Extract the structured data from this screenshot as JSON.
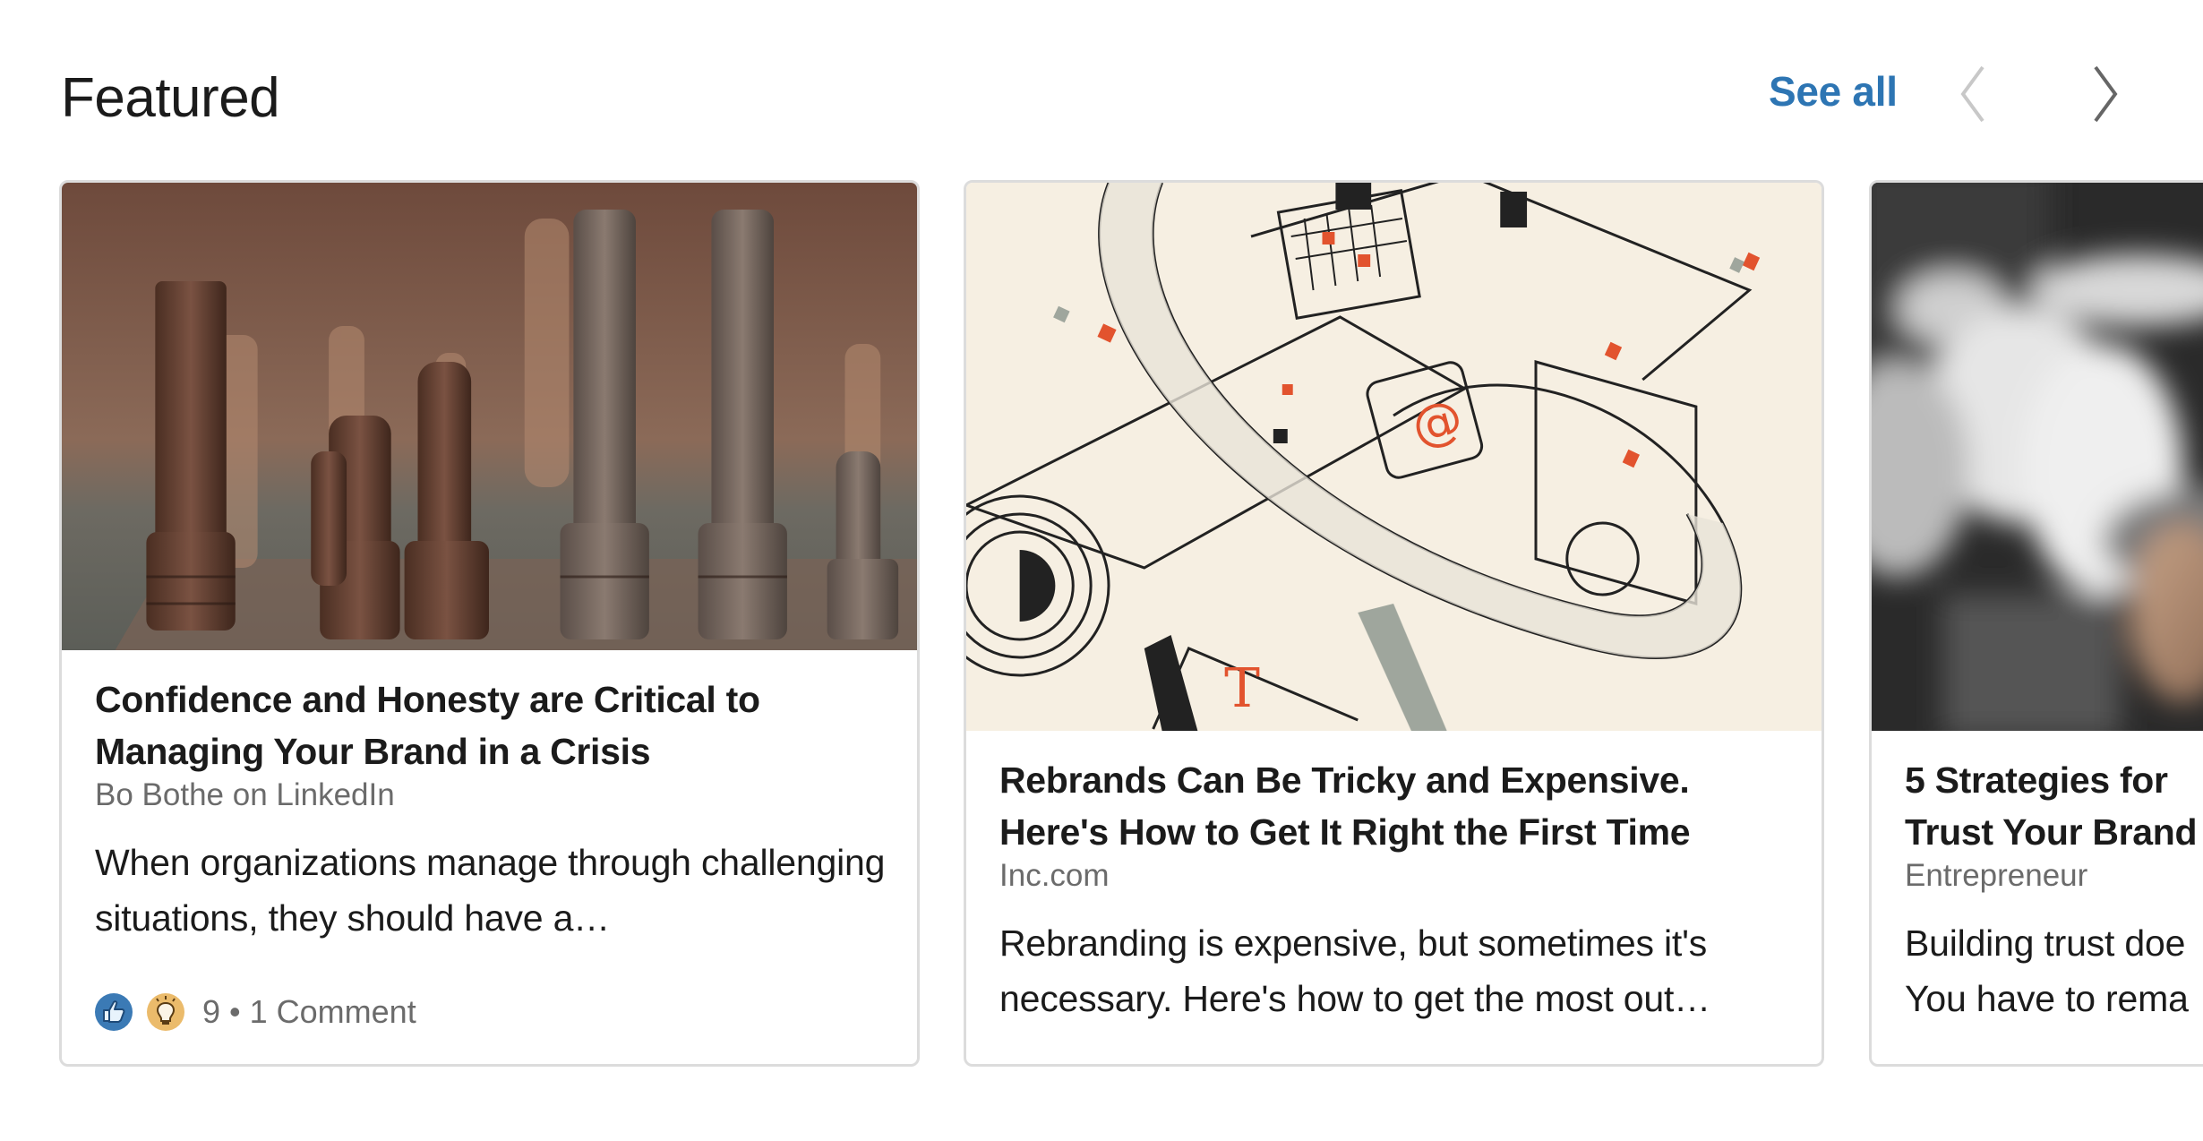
{
  "header": {
    "title": "Featured",
    "see_all_label": "See all",
    "prev_icon": "chevron-left-icon",
    "next_icon": "chevron-right-icon"
  },
  "colors": {
    "accent_link": "#2d75b3",
    "nav_disabled": "#c8c8c8",
    "nav_enabled": "#666666",
    "like_blue": "#3b7ab5",
    "insightful_gold": "#ebbb6b"
  },
  "cards": [
    {
      "title": "Confidence and Honesty are Critical to Managing Your Brand in a Crisis",
      "source": "Bo Bothe on LinkedIn",
      "description": "When organizations manage through challenging situations, they should have a…",
      "image_alt": "Wooden chess pieces on a chessboard",
      "reactions": [
        "like-icon",
        "insightful-icon"
      ],
      "reaction_count": "9",
      "separator": "•",
      "comments": "1 Comment"
    },
    {
      "title": "Rebrands Can Be Tricky and Expensive. Here's How to Get It Right the First Time",
      "source": "Inc.com",
      "description": "Rebranding is expensive, but sometimes it's necessary. Here's how to get the most out…",
      "image_alt": "Line illustration of devices wrapped in ribbon"
    },
    {
      "title_line1": "5 Strategies for",
      "title_line2": "Trust Your Brand",
      "source": "Entrepreneur",
      "desc_line1": "Building trust doe",
      "desc_line2": "You have to rema",
      "image_alt": "Blurred black and white crowd photo"
    }
  ]
}
